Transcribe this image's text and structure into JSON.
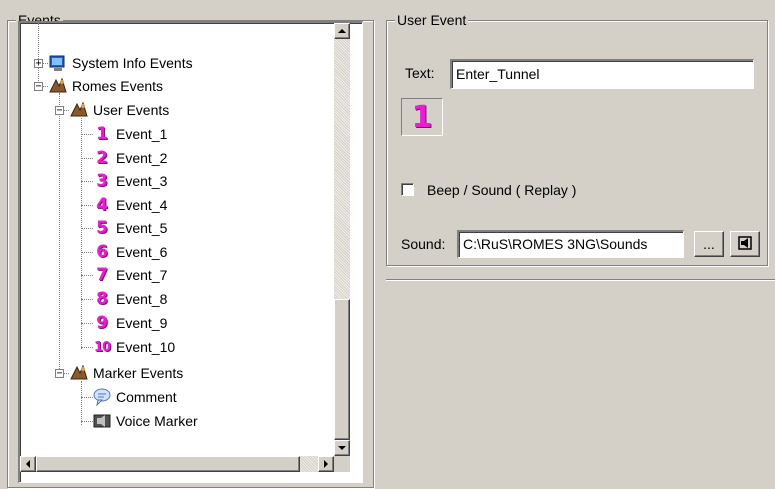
{
  "events_group": {
    "title": "Events",
    "tree": [
      {
        "label": "System Info Events",
        "icon": "system-info-icon",
        "expander": "+"
      },
      {
        "label": "Romes Events",
        "icon": "romes-events-icon",
        "expander": "−"
      },
      {
        "label": "User Events",
        "icon": "user-events-icon",
        "expander": "−"
      },
      {
        "label": "Event_1",
        "icon_text": "1"
      },
      {
        "label": "Event_2",
        "icon_text": "2"
      },
      {
        "label": "Event_3",
        "icon_text": "3"
      },
      {
        "label": "Event_4",
        "icon_text": "4"
      },
      {
        "label": "Event_5",
        "icon_text": "5"
      },
      {
        "label": "Event_6",
        "icon_text": "6"
      },
      {
        "label": "Event_7",
        "icon_text": "7"
      },
      {
        "label": "Event_8",
        "icon_text": "8"
      },
      {
        "label": "Event_9",
        "icon_text": "9"
      },
      {
        "label": "Event_10",
        "icon_text": "10"
      },
      {
        "label": "Marker Events",
        "icon": "marker-events-icon",
        "expander": "−"
      },
      {
        "label": "Comment",
        "icon": "comment-icon"
      },
      {
        "label": "Voice Marker",
        "icon": "voice-marker-icon"
      }
    ]
  },
  "user_event_group": {
    "title": "User Event",
    "text_label": "Text:",
    "text_value": "Enter_Tunnel",
    "number_display": "1",
    "beep_label": "Beep / Sound ( Replay )",
    "beep_checked": false,
    "sound_label": "Sound:",
    "sound_value": "C:\\RuS\\ROMES 3NG\\Sounds",
    "browse_label": "...",
    "play_icon": "speaker-icon"
  },
  "colors": {
    "event_number": "#e61fd3",
    "window_bg": "#d4d0c8"
  }
}
